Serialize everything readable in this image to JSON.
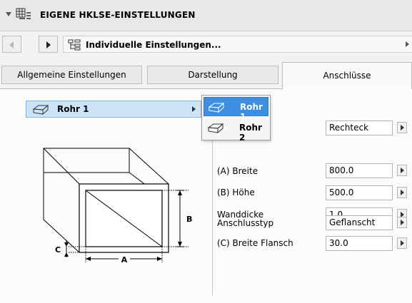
{
  "header": {
    "title": "EIGENE HKLSE-EINSTELLUNGEN",
    "collapse_icon": "triangle-down-icon",
    "icon": "grid-settings-icon"
  },
  "nav": {
    "prev_icon": "arrow-left-icon",
    "next_icon": "arrow-right-icon",
    "settings_label": "Individuelle Einstellungen...",
    "settings_icon": "settings-tree-icon"
  },
  "tabs": [
    {
      "label": "Allgemeine Einstellungen",
      "active": false
    },
    {
      "label": "Darstellung",
      "active": false
    },
    {
      "label": "Anschlüsse",
      "active": true
    }
  ],
  "rohr_select": {
    "value": "Rohr 1",
    "icon": "box-3d-icon"
  },
  "popup": {
    "items": [
      {
        "label": "Rohr 1",
        "selected": true
      },
      {
        "label": "Rohr 2",
        "selected": false
      }
    ]
  },
  "diagram": {
    "label_a": "A",
    "label_b": "B",
    "label_c": "C"
  },
  "params": [
    {
      "label": "",
      "value": "Rechteck"
    },
    {
      "label": "(A) Breite",
      "value": "800.0"
    },
    {
      "label": "(B) Höhe",
      "value": "500.0"
    },
    {
      "label": "Wanddicke",
      "value": "1.0"
    },
    {
      "label": "Anschlusstyp",
      "value": "Geflanscht"
    },
    {
      "label": "(C) Breite Flansch",
      "value": "30.0"
    }
  ],
  "colors": {
    "selection": "#3c8fe0",
    "dropdown_bg": "#cde4f7"
  }
}
